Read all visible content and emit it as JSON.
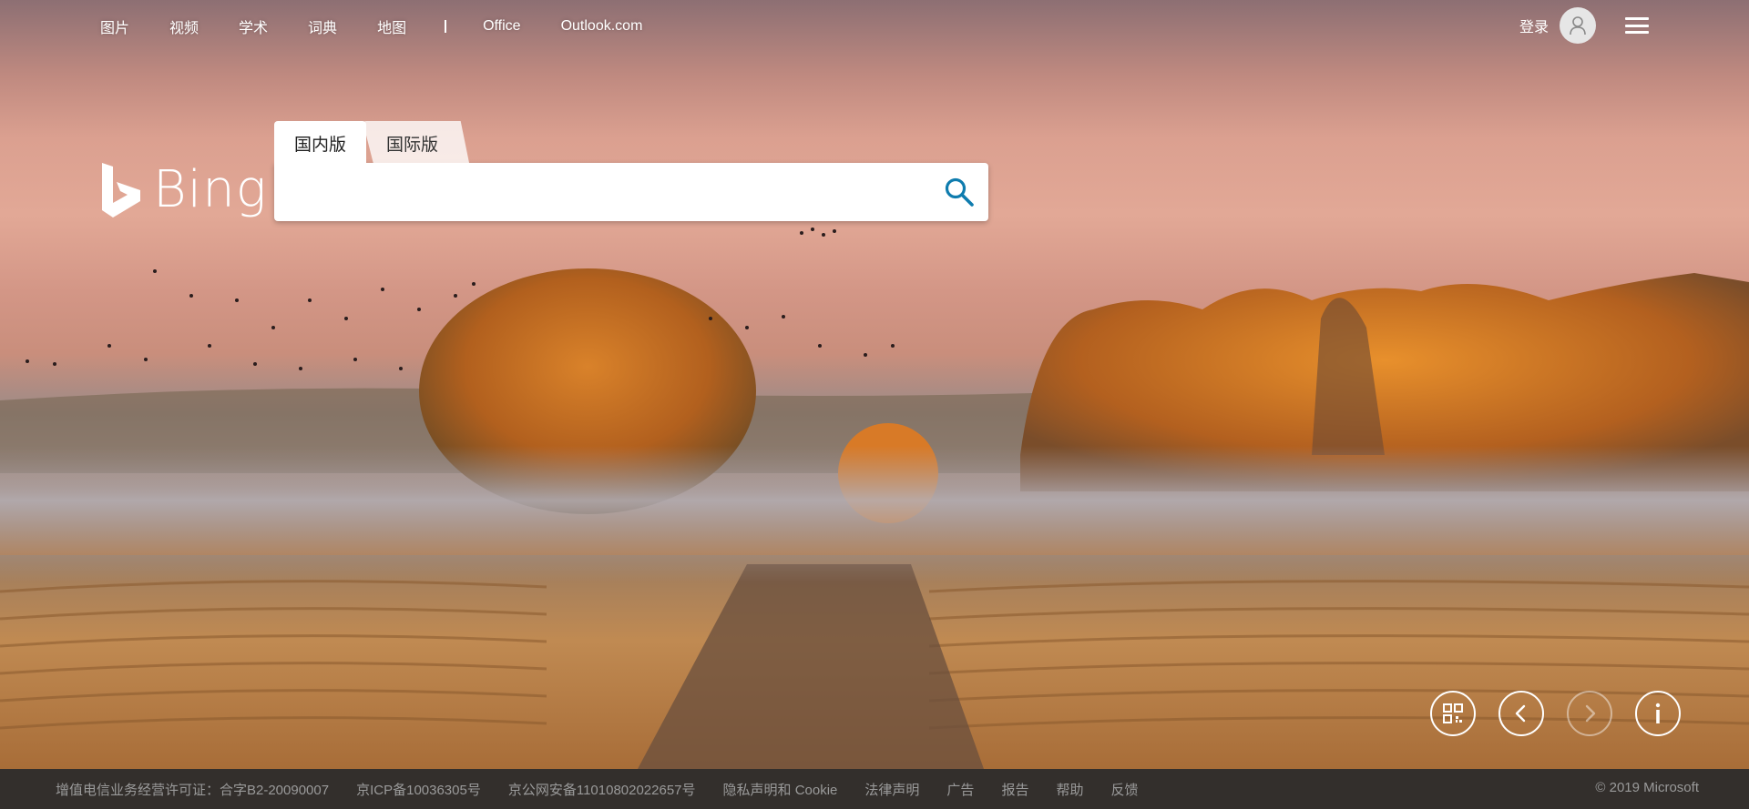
{
  "nav": {
    "links": [
      "图片",
      "视频",
      "学术",
      "词典",
      "地图"
    ],
    "external_links": [
      "Office",
      "Outlook.com"
    ],
    "login_label": "登录"
  },
  "logo": {
    "text": "Bing"
  },
  "search": {
    "tabs": [
      "国内版",
      "国际版"
    ],
    "active_tab": "国内版",
    "value": "",
    "placeholder": ""
  },
  "controls": [
    {
      "name": "qr-code-button",
      "icon": "qr-code-icon",
      "enabled": true
    },
    {
      "name": "previous-image-button",
      "icon": "chevron-left-icon",
      "enabled": true
    },
    {
      "name": "next-image-button",
      "icon": "chevron-right-icon",
      "enabled": false
    },
    {
      "name": "image-info-button",
      "icon": "info-icon",
      "enabled": true
    }
  ],
  "footer": {
    "links": [
      "增值电信业务经营许可证：合字B2-20090007",
      "京ICP备10036305号",
      "京公网安备11010802022657号",
      "隐私声明和 Cookie",
      "法律声明",
      "广告",
      "报告",
      "帮助",
      "反馈"
    ],
    "copyright": "© 2019 Microsoft"
  },
  "colors": {
    "search_icon": "#0f7cae",
    "footer_bg": "#282828",
    "footer_text": "#9a9a9a"
  }
}
